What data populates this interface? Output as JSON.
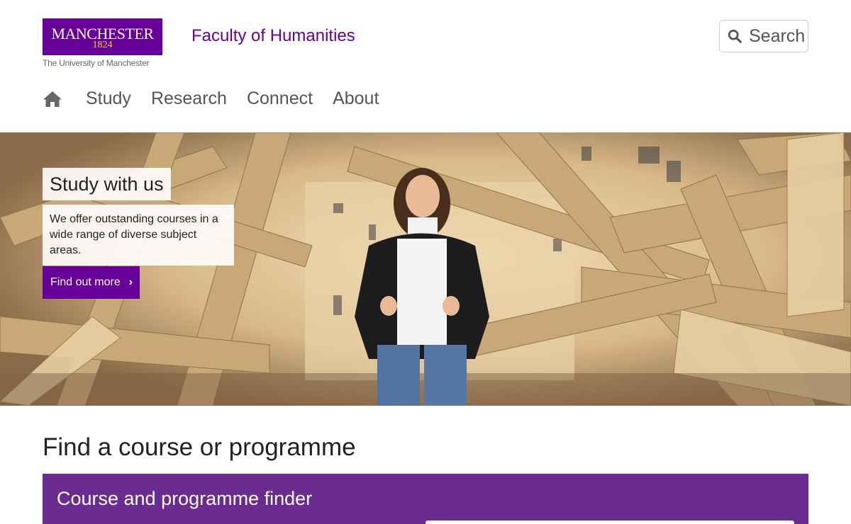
{
  "header": {
    "logo": {
      "wordmark": "MANCHESTER",
      "year": "1824",
      "subtitle": "The University of Manchester"
    },
    "faculty_title": "Faculty of Humanities",
    "search": {
      "label": "Search",
      "icon": "search-icon"
    }
  },
  "nav": {
    "home_icon": "home-icon",
    "items": [
      {
        "label": "Study"
      },
      {
        "label": "Research"
      },
      {
        "label": "Connect"
      },
      {
        "label": "About"
      }
    ]
  },
  "hero": {
    "title": "Study with us",
    "description": "We offer outstanding courses in a wide range of diverse subject areas.",
    "cta_label": "Find out more",
    "cta_icon": "chevron-right-icon"
  },
  "finder": {
    "heading": "Find a course or programme",
    "panel_title": "Course and programme finder"
  },
  "colors": {
    "brand_purple": "#660099",
    "brand_gold": "#ffcc33",
    "panel_purple": "#6b2c91"
  }
}
